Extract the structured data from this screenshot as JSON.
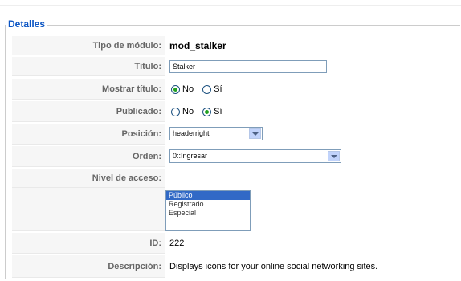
{
  "legend": "Detalles",
  "fields": {
    "tipo": {
      "label": "Tipo de módulo:",
      "value": "mod_stalker"
    },
    "titulo": {
      "label": "Título:",
      "value": "Stalker"
    },
    "mostrar": {
      "label": "Mostrar título:",
      "no": "No",
      "si": "Sí",
      "selected": "No"
    },
    "publicado": {
      "label": "Publicado:",
      "no": "No",
      "si": "Sí",
      "selected": "Sí"
    },
    "posicion": {
      "label": "Posición:",
      "value": "headerright"
    },
    "orden": {
      "label": "Orden:",
      "value": "0::Ingresar"
    },
    "nivel": {
      "label": "Nivel de acceso:",
      "options": [
        "Público",
        "Registrado",
        "Especial"
      ],
      "selected": "Público"
    },
    "id": {
      "label": "ID:",
      "value": "222"
    },
    "descripcion": {
      "label": "Descripción:",
      "value": "Displays icons for your online social networking sites."
    }
  }
}
